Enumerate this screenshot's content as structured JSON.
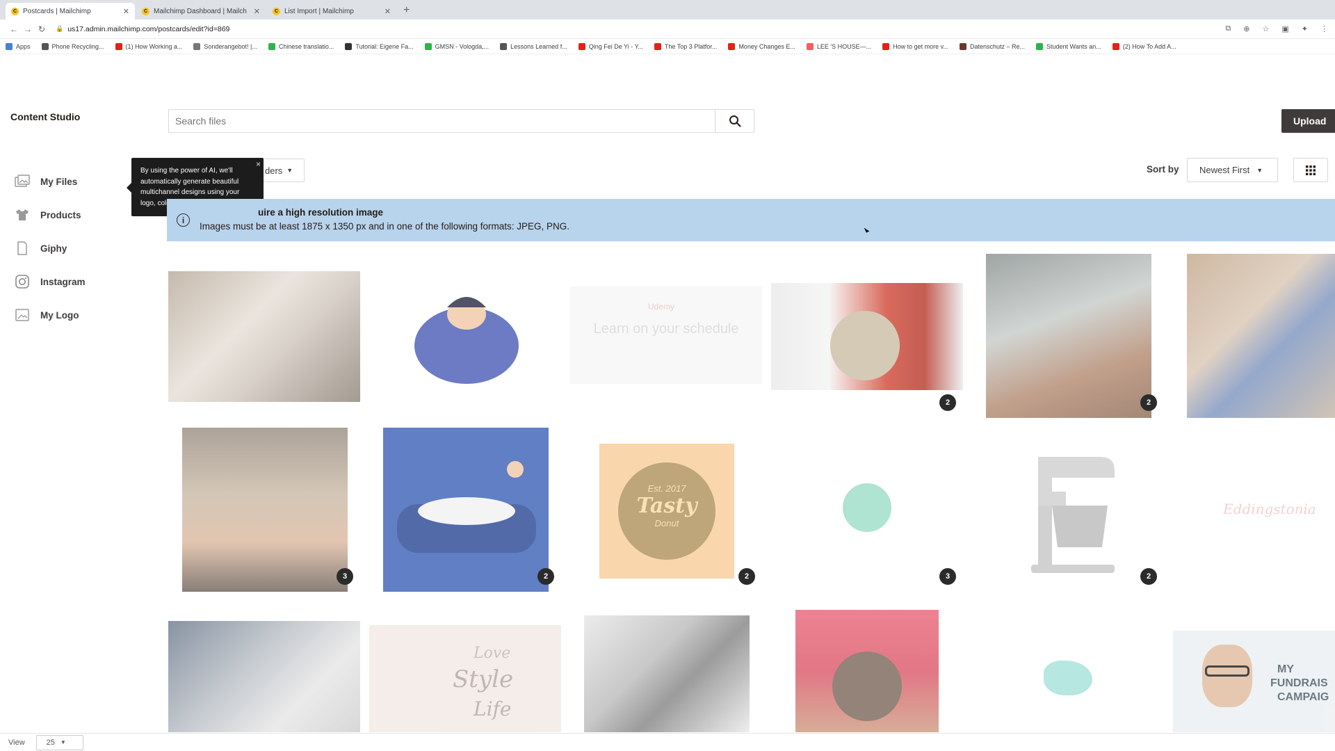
{
  "browser": {
    "tabs": [
      {
        "title": "Postcards | Mailchimp",
        "active": true
      },
      {
        "title": "Mailchimp Dashboard | Mailch",
        "active": false
      },
      {
        "title": "List Import | Mailchimp",
        "active": false
      }
    ],
    "new_tab": "+",
    "url": "us17.admin.mailchimp.com/postcards/edit?id=869",
    "bookmarks": [
      {
        "label": "Apps",
        "color": "#4a7ed8"
      },
      {
        "label": "Phone Recycling...",
        "color": "#555555"
      },
      {
        "label": "(1) How Working a...",
        "color": "#e62117"
      },
      {
        "label": "Sonderangebot! |...",
        "color": "#777777"
      },
      {
        "label": "Chinese translatio...",
        "color": "#2db34a"
      },
      {
        "label": "Tutorial: Eigene Fa...",
        "color": "#333333"
      },
      {
        "label": "GMSN - Vologda,...",
        "color": "#2db34a"
      },
      {
        "label": "Lessons Learned f...",
        "color": "#555555"
      },
      {
        "label": "Qing Fei De Yi - Y...",
        "color": "#e62117"
      },
      {
        "label": "The Top 3 Platfor...",
        "color": "#e62117"
      },
      {
        "label": "Money Changes E...",
        "color": "#e62117"
      },
      {
        "label": "LEE 'S HOUSE—...",
        "color": "#ff5a5f"
      },
      {
        "label": "How to get more v...",
        "color": "#e62117"
      },
      {
        "label": "Datenschutz – Re...",
        "color": "#6b3a2a"
      },
      {
        "label": "Student Wants an...",
        "color": "#2db34a"
      },
      {
        "label": "(2) How To Add A...",
        "color": "#e62117"
      }
    ]
  },
  "page": {
    "title": "Content Studio",
    "sidebar": [
      {
        "label": "My Files",
        "icon": "image-stack-icon"
      },
      {
        "label": "Products",
        "icon": "shirt-icon"
      },
      {
        "label": "Giphy",
        "icon": "giphy-icon"
      },
      {
        "label": "Instagram",
        "icon": "instagram-icon"
      },
      {
        "label": "My Logo",
        "icon": "logo-image-icon"
      }
    ],
    "search": {
      "placeholder": "Search files"
    },
    "upload_label": "Upload",
    "folders_label": "ders",
    "tooltip": "By using the power of AI, we'll automatically generate beautiful multichannel designs using your logo, colors, and fonts.",
    "sort_label": "Sort by",
    "sort_value": "Newest First",
    "banner": {
      "title": "uire a high resolution image",
      "text": "Images must be at least 1875 x 1350 px and in one of the following formats: JPEG, PNG."
    },
    "footer": {
      "label": "View",
      "per_page": "25"
    },
    "tile_texts": {
      "udemy_brand": "Udemy",
      "udemy_headline": "Learn on your schedule",
      "tasty_line1": "Est. 2017",
      "tasty_line2": "Tasty",
      "tasty_line3": "Donut",
      "script_word": "Eddingstonia",
      "love_line1": "Love",
      "love_line2": "Style",
      "love_line3": "Life",
      "fundraise_line1": "MY",
      "fundraise_line2": "FUNDRAIS",
      "fundraise_line3": "CAMPAIG"
    },
    "badges": [
      "2",
      "2",
      "3",
      "2",
      "2",
      "3",
      "2"
    ]
  }
}
